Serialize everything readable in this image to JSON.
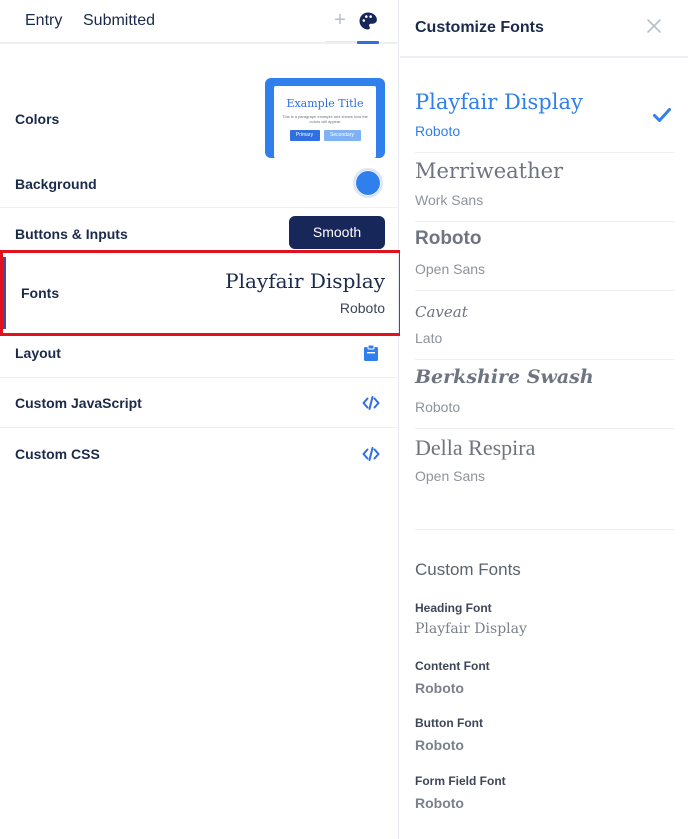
{
  "tabs": {
    "entry": "Entry",
    "submitted": "Submitted",
    "plus": "+"
  },
  "settings": {
    "colors": {
      "label": "Colors",
      "preview": {
        "title": "Example Title",
        "text": "This is a paragraph example and shows how the colors will appear",
        "primary": "Primary",
        "secondary": "Secondary"
      }
    },
    "background": {
      "label": "Background",
      "color": "#2f80ed"
    },
    "buttons": {
      "label": "Buttons & Inputs",
      "value": "Smooth"
    },
    "fonts": {
      "label": "Fonts",
      "heading": "Playfair Display",
      "body": "Roboto"
    },
    "layout": {
      "label": "Layout",
      "icon": "clipboard-icon"
    },
    "custom_js": {
      "label": "Custom JavaScript",
      "icon": "code-icon"
    },
    "custom_css": {
      "label": "Custom CSS",
      "icon": "code-icon"
    }
  },
  "panel": {
    "title": "Customize Fonts",
    "close_icon": "close-icon",
    "options": [
      {
        "heading": "Playfair Display",
        "body": "Roboto",
        "selected": true
      },
      {
        "heading": "Merriweather",
        "body": "Work Sans",
        "selected": false
      },
      {
        "heading": "Roboto",
        "body": "Open Sans",
        "selected": false
      },
      {
        "heading": "Caveat",
        "body": "Lato",
        "selected": false
      },
      {
        "heading": "Berkshire Swash",
        "body": "Roboto",
        "selected": false
      },
      {
        "heading": "Della Respira",
        "body": "Open Sans",
        "selected": false
      }
    ],
    "custom": {
      "title": "Custom Fonts",
      "heading_label": "Heading Font",
      "heading_value": "Playfair Display",
      "content_label": "Content Font",
      "content_value": "Roboto",
      "button_label": "Button Font",
      "button_value": "Roboto",
      "field_label": "Form Field Font",
      "field_value": "Roboto"
    }
  },
  "colors": {
    "accent": "#2f80ed",
    "navy": "#17275a",
    "highlight": "#e0121e"
  }
}
